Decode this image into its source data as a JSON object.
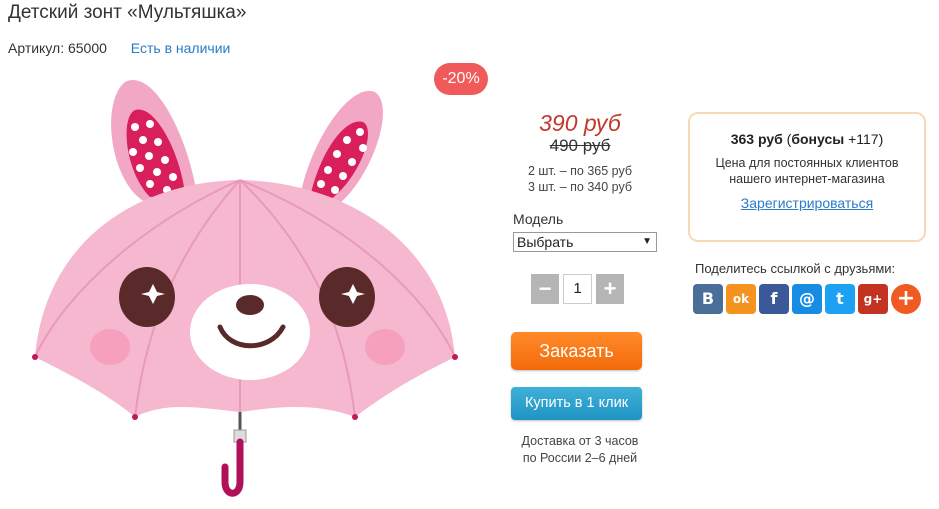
{
  "product": {
    "title": "Детский зонт «Мультяшка»",
    "sku_label": "Артикул: 65000",
    "stock_label": "Есть в наличии",
    "image_alt": "pink rabbit kids umbrella",
    "discount_badge": "-20%"
  },
  "pricing": {
    "price_new": "390 руб",
    "price_old": "490 руб",
    "tiers": [
      "2 шт. – по 365 руб",
      "3 шт. – по 340 руб"
    ]
  },
  "options": {
    "model_label": "Модель",
    "model_selected": "Выбрать"
  },
  "quantity": {
    "minus": "−",
    "value": "1",
    "plus": "+"
  },
  "actions": {
    "order_label": "Заказать",
    "oneclick_label": "Купить в 1 клик"
  },
  "delivery": {
    "line1": "Доставка от 3 часов",
    "line2": "по России 2–6 дней"
  },
  "bonus": {
    "price": "363 руб",
    "bonus_open": " (",
    "bonus_word": "бонусы",
    "bonus_value": " +117)",
    "desc_line1": "Цена для постоянных клиентов",
    "desc_line2": "нашего интернет-магазина",
    "register_link": "Зарегистрироваться"
  },
  "share": {
    "label": "Поделитесь ссылкой с друзьями:",
    "icons": [
      {
        "name": "vk-icon",
        "glyph": "В",
        "color": "#4a6e97"
      },
      {
        "name": "odnoklassniki-icon",
        "glyph": "ok",
        "color": "#f59320"
      },
      {
        "name": "facebook-icon",
        "glyph": "f",
        "color": "#3b5998"
      },
      {
        "name": "mailru-icon",
        "glyph": "@",
        "color": "#168de2"
      },
      {
        "name": "twitter-icon",
        "glyph": "t",
        "color": "#1da1f2"
      },
      {
        "name": "google-plus-icon",
        "glyph": "g+",
        "color": "#c23321"
      },
      {
        "name": "more-share-icon",
        "glyph": "+",
        "color": "#f15a22"
      }
    ]
  },
  "colors": {
    "accent_price": "#c0392b",
    "link": "#2a7bc8",
    "order_button": "#f26a0a",
    "oneclick_button": "#1f94c3",
    "badge": "#f15a5a"
  }
}
